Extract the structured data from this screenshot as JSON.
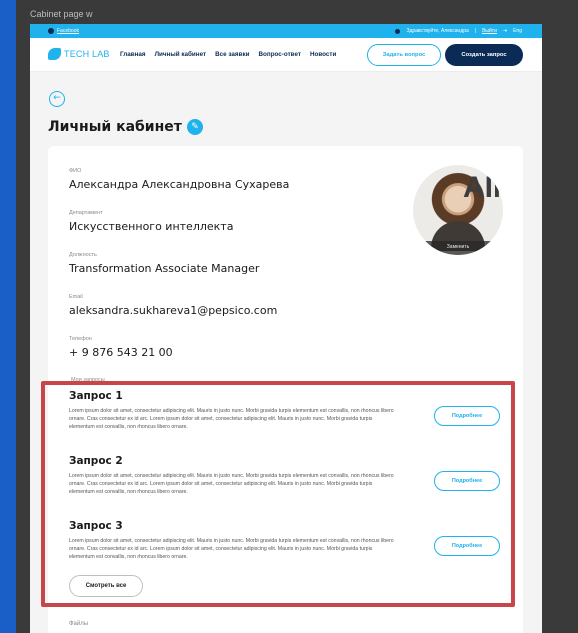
{
  "artboard": {
    "title": "Cabinet page w"
  },
  "topbar": {
    "facebook": "Facebook",
    "greeting": "Здравствуйте, Александра",
    "separator": "|",
    "logout": "Выйти",
    "lang": "Eng"
  },
  "header": {
    "logo": "TECH LAB",
    "nav": [
      "Главная",
      "Личный кабинет",
      "Все заявки",
      "Вопрос-ответ",
      "Новости"
    ],
    "ask_button": "Задать вопрос",
    "create_button": "Создать запрос"
  },
  "page": {
    "back": "←",
    "title": "Личный кабинет",
    "edit": "✎"
  },
  "profile": {
    "fields": [
      {
        "label": "ФИО",
        "value": "Александра Александровна Сухарева"
      },
      {
        "label": "Департамент",
        "value": "Искусственного интеллекта"
      },
      {
        "label": "Должность",
        "value": "Transformation Associate Manager"
      },
      {
        "label": "Email",
        "value": "aleksandra.sukhareva1@pepsico.com"
      },
      {
        "label": "Телефон",
        "value": "+ 9 876 543 21 00"
      }
    ],
    "avatar_bg_text": "AIM",
    "avatar_replace": "Заменить"
  },
  "requests": {
    "section_label": "Мои запросы",
    "items": [
      {
        "title": "Запрос 1",
        "text": "Lorem ipsum dolor sit amet, consectetur adipiscing elit. Mauris in justo nunc. Morbi gravida turpis elementum est convallis, non rhoncus libero ornare. Cras consectetur ex id arc. Lorem ipsum dolor sit amet, consectetur adipiscing elit. Mauris in justo nunc. Morbi gravida turpis elementum est convallis, non rhoncus libero ornare.",
        "more": "Подробнее"
      },
      {
        "title": "Запрос 2",
        "text": "Lorem ipsum dolor sit amet, consectetur adipiscing elit. Mauris in justo nunc. Morbi gravida turpis elementum est convallis, non rhoncus libero ornare. Cras consectetur ex id arc. Lorem ipsum dolor sit amet, consectetur adipiscing elit. Mauris in justo nunc. Morbi gravida turpis elementum est convallis, non rhoncus libero ornare.",
        "more": "Подробнее"
      },
      {
        "title": "Запрос 3",
        "text": "Lorem ipsum dolor sit amet, consectetur adipiscing elit. Mauris in justo nunc. Morbi gravida turpis elementum est convallis, non rhoncus libero ornare. Cras consectetur ex id arc. Lorem ipsum dolor sit amet, consectetur adipiscing elit. Mauris in justo nunc. Morbi gravida turpis elementum est convallis, non rhoncus libero ornare.",
        "more": "Подробнее"
      }
    ],
    "see_all": "Смотреть все"
  },
  "files": {
    "label": "Файлы"
  },
  "colors": {
    "accent": "#1fb2ec",
    "navy": "#0b2b56",
    "highlight": "#c7464b"
  }
}
